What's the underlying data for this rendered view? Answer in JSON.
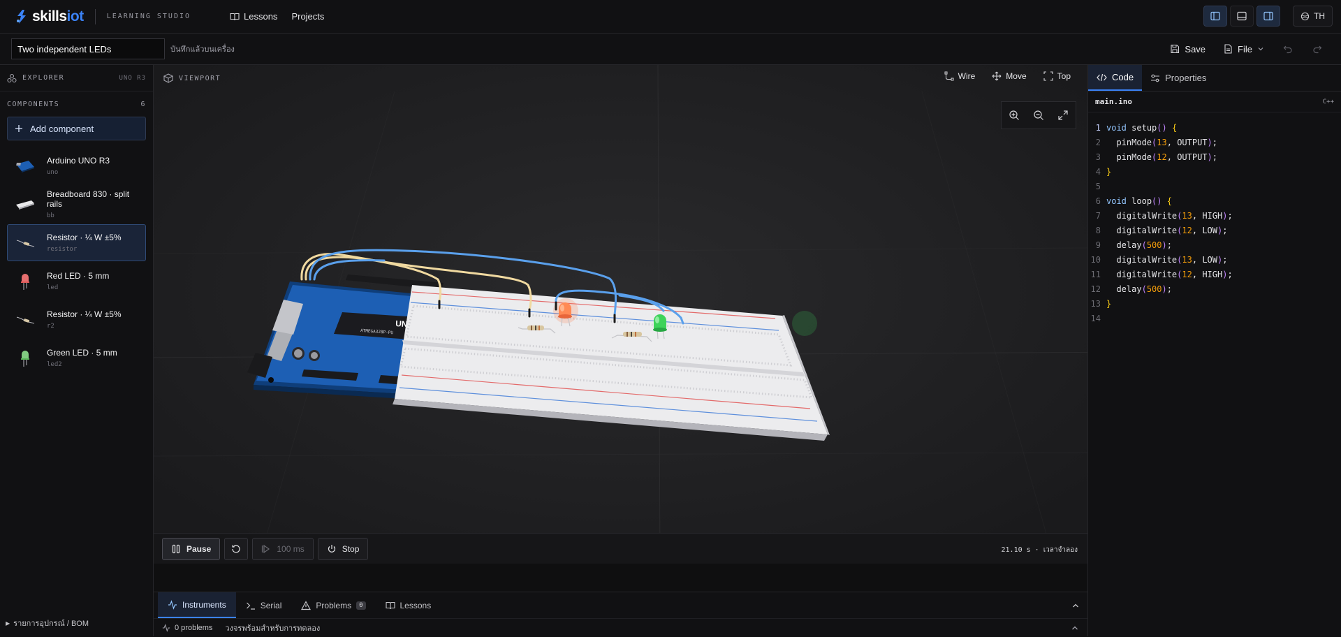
{
  "brand": {
    "name_prefix": "skills",
    "name_suffix": "iot",
    "subtitle": "LEARNING STUDIO"
  },
  "nav": [
    {
      "label": "Lessons"
    },
    {
      "label": "Projects"
    }
  ],
  "lang_button": "TH",
  "project": {
    "title": "Two independent LEDs",
    "saved_note": "บันทึกแล้วบนเครื่อง"
  },
  "actions": {
    "save": "Save",
    "file": "File"
  },
  "explorer": {
    "label": "EXPLORER",
    "board": "UNO R3"
  },
  "components_section": {
    "label": "COMPONENTS",
    "count": "6",
    "add_label": "Add component"
  },
  "components": [
    {
      "name": "Arduino UNO R3",
      "id": "uno",
      "type": "board",
      "selected": false
    },
    {
      "name": "Breadboard 830 · split rails",
      "id": "bb",
      "type": "breadboard",
      "selected": false
    },
    {
      "name": "Resistor · ¼ W ±5%",
      "id": "resistor",
      "type": "resistor",
      "selected": true
    },
    {
      "name": "Red LED · 5 mm",
      "id": "led",
      "type": "led-red",
      "selected": false
    },
    {
      "name": "Resistor · ¼ W ±5%",
      "id": "r2",
      "type": "resistor",
      "selected": false
    },
    {
      "name": "Green LED · 5 mm",
      "id": "led2",
      "type": "led-green",
      "selected": false
    }
  ],
  "bom_label": "รายการอุปกรณ์ / BOM",
  "viewport": {
    "label": "VIEWPORT",
    "tools": {
      "wire": "Wire",
      "move": "Move",
      "top": "Top"
    }
  },
  "board_text": {
    "uno": "UNO",
    "chip": "ATMEGA328P-PU"
  },
  "sim": {
    "pause": "Pause",
    "step": "100 ms",
    "stop": "Stop",
    "time": "21.10 s · เวลาจำลอง"
  },
  "bottom_tabs": [
    {
      "label": "Instruments",
      "active": true
    },
    {
      "label": "Serial",
      "active": false
    },
    {
      "label": "Problems",
      "active": false,
      "badge": "0"
    },
    {
      "label": "Lessons",
      "active": false
    }
  ],
  "status": {
    "problems": "0 problems",
    "message": "วงจรพร้อมสำหรับการทดลอง"
  },
  "right_tabs": {
    "code": "Code",
    "properties": "Properties"
  },
  "editor": {
    "file": "main.ino",
    "lang": "C++"
  },
  "code_lines": [
    "void setup() {",
    "  pinMode(13, OUTPUT);",
    "  pinMode(12, OUTPUT);",
    "}",
    "",
    "void loop() {",
    "  digitalWrite(13, HIGH);",
    "  digitalWrite(12, LOW);",
    "  delay(500);",
    "  digitalWrite(13, LOW);",
    "  digitalWrite(12, HIGH);",
    "  delay(500);",
    "}",
    ""
  ],
  "colors": {
    "accent": "#3b82f6",
    "board": "#1d5fb4",
    "led_red": "#ff7a4a",
    "led_green": "#3ed35a"
  }
}
